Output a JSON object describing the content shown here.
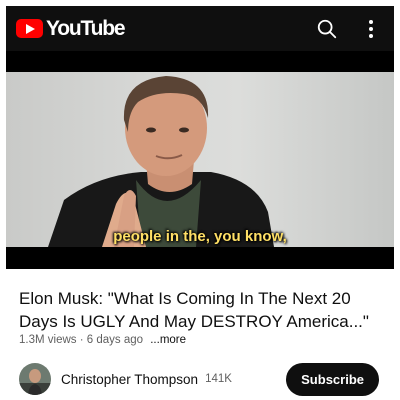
{
  "header": {
    "logo_text": "YouTube",
    "icons": {
      "search": "search-icon",
      "more": "more-vert-icon"
    },
    "brand_color": "#ff0000"
  },
  "video": {
    "caption": "people in the, you know,",
    "caption_color": "#ffe066"
  },
  "details": {
    "title": "Elon Musk: \"What Is Coming In The Next 20 Days Is UGLY And May DESTROY America...\"",
    "views": "1.3M views",
    "separator": " · ",
    "age": "6 days ago",
    "more_label": "...more"
  },
  "channel": {
    "name": "Christopher Thompson",
    "subscribers": "141K",
    "subscribe_label": "Subscribe"
  }
}
